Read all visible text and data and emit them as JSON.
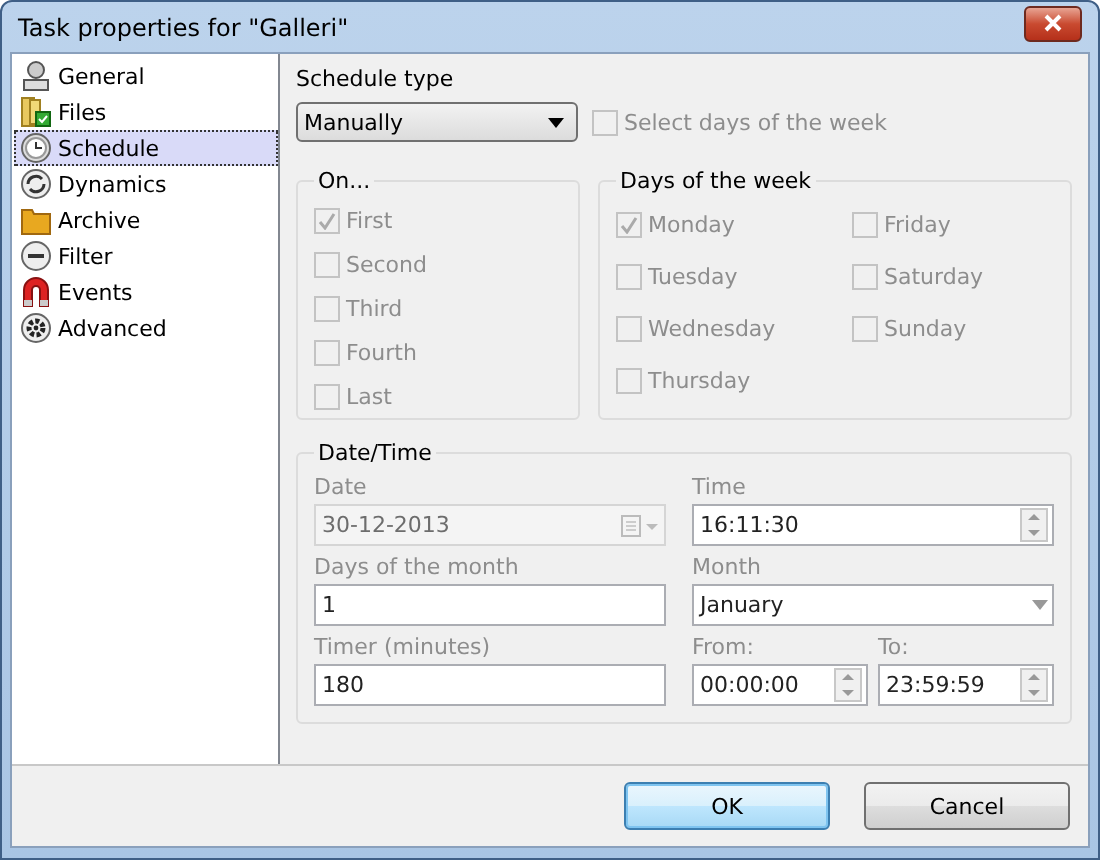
{
  "window": {
    "title": "Task properties for \"Galleri\""
  },
  "sidebar": {
    "items": [
      {
        "label": "General",
        "selected": false
      },
      {
        "label": "Files",
        "selected": false
      },
      {
        "label": "Schedule",
        "selected": true
      },
      {
        "label": "Dynamics",
        "selected": false
      },
      {
        "label": "Archive",
        "selected": false
      },
      {
        "label": "Filter",
        "selected": false
      },
      {
        "label": "Events",
        "selected": false
      },
      {
        "label": "Advanced",
        "selected": false
      }
    ]
  },
  "schedule_type": {
    "label": "Schedule type",
    "value": "Manually"
  },
  "select_days": {
    "label": "Select days of the week",
    "checked": false,
    "disabled": true
  },
  "on_group": {
    "title": "On...",
    "items": [
      {
        "label": "First",
        "checked": true,
        "disabled": true
      },
      {
        "label": "Second",
        "checked": false,
        "disabled": true
      },
      {
        "label": "Third",
        "checked": false,
        "disabled": true
      },
      {
        "label": "Fourth",
        "checked": false,
        "disabled": true
      },
      {
        "label": "Last",
        "checked": false,
        "disabled": true
      }
    ]
  },
  "days_group": {
    "title": "Days of the week",
    "items": [
      {
        "label": "Monday",
        "checked": true,
        "disabled": true
      },
      {
        "label": "Friday",
        "checked": false,
        "disabled": true
      },
      {
        "label": "Tuesday",
        "checked": false,
        "disabled": true
      },
      {
        "label": "Saturday",
        "checked": false,
        "disabled": true
      },
      {
        "label": "Wednesday",
        "checked": false,
        "disabled": true
      },
      {
        "label": "Sunday",
        "checked": false,
        "disabled": true
      },
      {
        "label": "Thursday",
        "checked": false,
        "disabled": true
      }
    ]
  },
  "datetime_group": {
    "title": "Date/Time",
    "fields": [
      {
        "label": "Date",
        "value": "30-12-2013",
        "kind": "date",
        "disabled": true
      },
      {
        "label": "Time",
        "value": "16:11:30",
        "kind": "spin",
        "disabled": false
      },
      {
        "label": "Days of the month",
        "value": "1",
        "kind": "text",
        "disabled": false
      },
      {
        "label": "Month",
        "value": "January",
        "kind": "select",
        "disabled": false
      },
      {
        "label": "Timer (minutes)",
        "value": "180",
        "kind": "text",
        "disabled": false
      },
      {
        "label": "From:",
        "value": "00:00:00",
        "kind": "spin",
        "disabled": false
      },
      {
        "label": "To:",
        "value": "23:59:59",
        "kind": "spin",
        "disabled": false
      }
    ]
  },
  "buttons": [
    {
      "label": "OK",
      "default": true
    },
    {
      "label": "Cancel",
      "default": false
    }
  ]
}
